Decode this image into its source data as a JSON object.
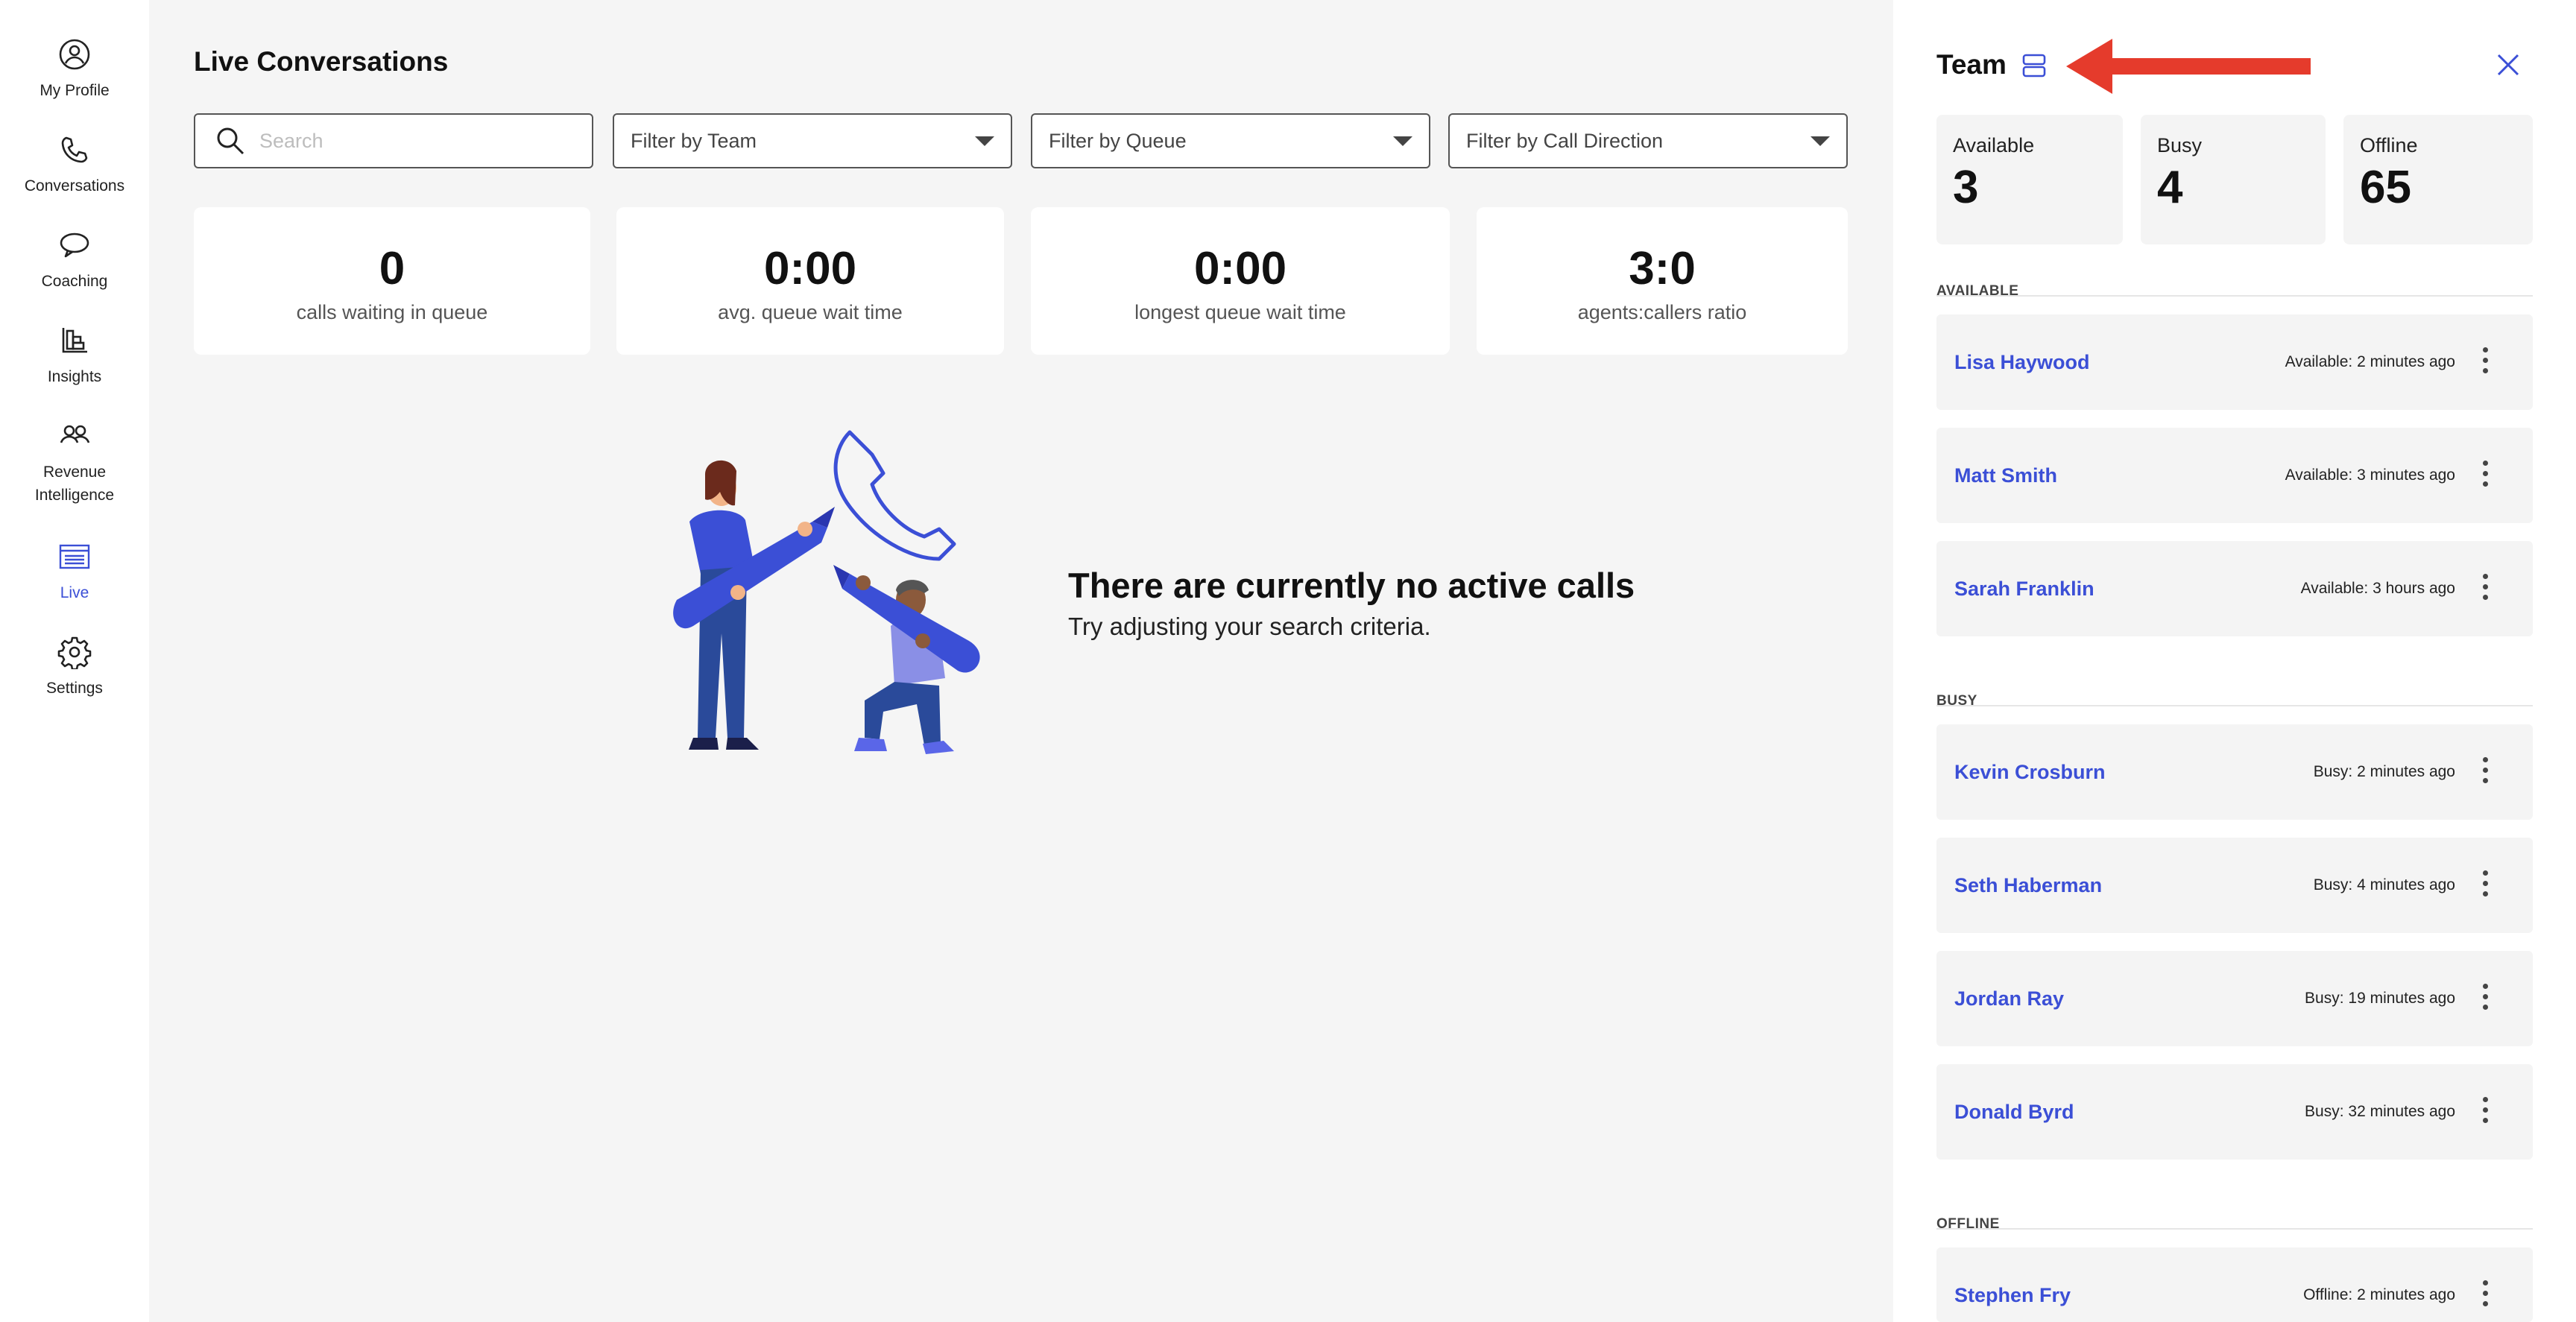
{
  "nav": {
    "items": [
      {
        "label": "My Profile",
        "icon": "user-circle-icon"
      },
      {
        "label": "Conversations",
        "icon": "phone-icon"
      },
      {
        "label": "Coaching",
        "icon": "chat-bubble-icon"
      },
      {
        "label": "Insights",
        "icon": "bar-chart-icon"
      },
      {
        "label": "Revenue\nIntelligence",
        "icon": "people-icon"
      },
      {
        "label": "Live",
        "icon": "live-list-icon"
      },
      {
        "label": "Settings",
        "icon": "gear-icon"
      }
    ],
    "active": "Live",
    "active_color": "#3b4fd6"
  },
  "main": {
    "title": "Live Conversations",
    "search_placeholder": "Search",
    "filters": {
      "team": "Filter by Team",
      "queue": "Filter by Queue",
      "direction": "Filter by Call Direction"
    },
    "stats": [
      {
        "value": "0",
        "label": "calls waiting in queue"
      },
      {
        "value": "0:00",
        "label": "avg. queue wait time"
      },
      {
        "value": "0:00",
        "label": "longest queue wait time"
      },
      {
        "value": "3:0",
        "label": "agents:callers ratio"
      }
    ],
    "empty": {
      "title": "There are currently no active calls",
      "subtitle": "Try adjusting your search criteria."
    }
  },
  "team": {
    "title": "Team",
    "counts": {
      "available_label": "Available",
      "available": "3",
      "busy_label": "Busy",
      "busy": "4",
      "offline_label": "Offline",
      "offline": "65"
    },
    "sections": {
      "available": "AVAILABLE",
      "busy": "BUSY",
      "offline": "OFFLINE"
    },
    "available_members": [
      {
        "name": "Lisa Haywood",
        "status": "Available: 2 minutes ago"
      },
      {
        "name": "Matt Smith",
        "status": "Available: 3 minutes ago"
      },
      {
        "name": "Sarah Franklin",
        "status": "Available: 3 hours ago"
      }
    ],
    "busy_members": [
      {
        "name": "Kevin Crosburn",
        "status": "Busy: 2 minutes ago"
      },
      {
        "name": "Seth Haberman",
        "status": "Busy: 4 minutes ago"
      },
      {
        "name": "Jordan Ray",
        "status": "Busy: 19 minutes ago"
      },
      {
        "name": "Donald Byrd",
        "status": "Busy: 32 minutes ago"
      }
    ],
    "offline_members": [
      {
        "name": "Stephen Fry",
        "status": "Offline: 2 minutes ago"
      }
    ],
    "link_color": "#3b4fd6",
    "annotation_arrow_color": "#e53b2c"
  }
}
